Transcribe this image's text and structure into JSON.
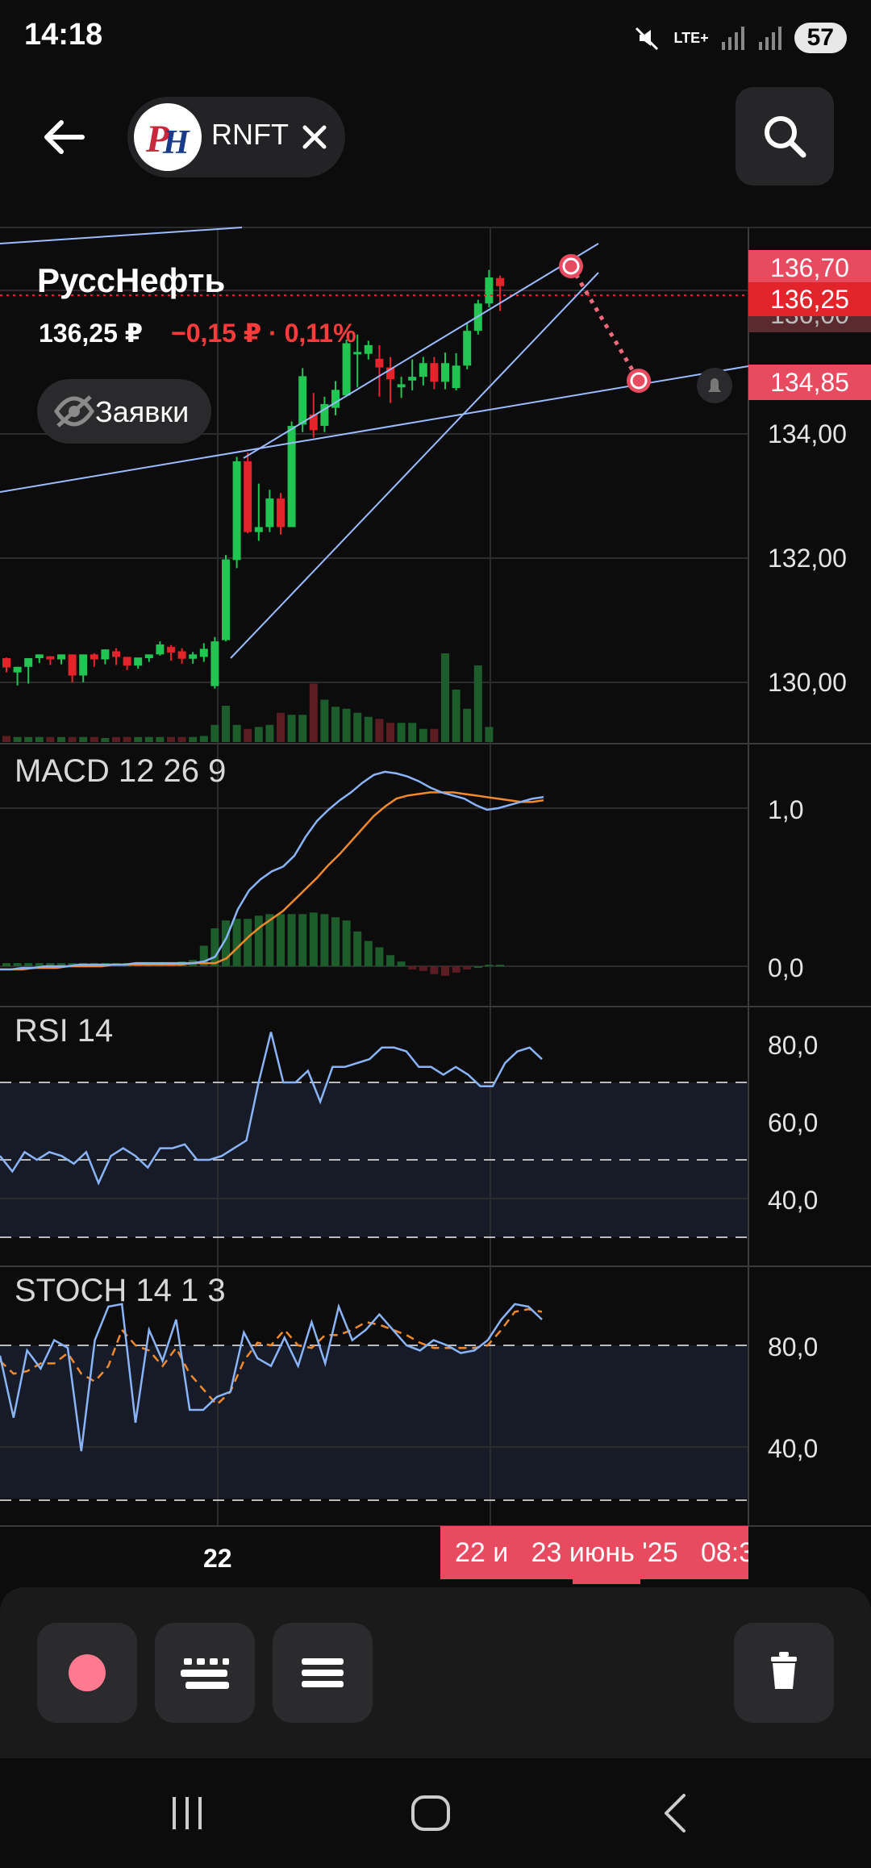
{
  "status_bar": {
    "time": "14:18",
    "network": "LTE+",
    "battery": "57",
    "icons": [
      "mute-icon",
      "lte-icon",
      "signal-icon",
      "signal-icon",
      "battery-icon"
    ]
  },
  "header": {
    "ticker": "RNFT",
    "logo_text": "PH",
    "back_icon": "arrow-left-icon",
    "close_icon": "close-icon",
    "search_icon": "search-icon"
  },
  "instrument": {
    "name": "РуссНефть",
    "price": "136,25 ₽",
    "change": "−0,15 ₽ · 0,11%",
    "orders_label": "Заявки",
    "orders_icon": "eye-off-icon"
  },
  "colors": {
    "up": "#23c552",
    "down": "#e3242b",
    "line_blue": "#8ab4f8",
    "signal_orange": "#f08a2c",
    "accent_red": "#e84a5f",
    "drawing_line": "#9bbcff"
  },
  "price_tags": {
    "top": "136,70",
    "current": "136,25",
    "target": "134,85",
    "hidden": "136,00"
  },
  "time_axis": {
    "tick": "22",
    "cursor_label": "22 и   23 июнь '25   08:3("
  },
  "toolbar": {
    "buttons": [
      "record-button",
      "indicators-button",
      "menu-button",
      "delete-button"
    ]
  },
  "chart_data": [
    {
      "type": "candlestick",
      "title": "РуссНефть",
      "y_ticks": [
        "134,00",
        "132,00",
        "130,00"
      ],
      "ylim": [
        129.0,
        137.2
      ],
      "candles": [
        [
          130.39,
          130.4,
          130.24,
          130.16
        ],
        [
          130.16,
          130.25,
          130.25,
          129.95
        ],
        [
          130.25,
          130.36,
          130.39,
          129.98
        ],
        [
          130.39,
          130.45,
          130.45,
          130.31
        ],
        [
          130.42,
          130.42,
          130.37,
          130.28
        ],
        [
          130.37,
          130.45,
          130.45,
          130.29
        ],
        [
          130.45,
          130.45,
          130.11,
          130.0
        ],
        [
          130.11,
          130.45,
          130.45,
          130.0
        ],
        [
          130.45,
          130.47,
          130.37,
          130.25
        ],
        [
          130.37,
          130.53,
          130.53,
          130.29
        ],
        [
          130.5,
          130.55,
          130.41,
          130.28
        ],
        [
          130.41,
          130.41,
          130.27,
          130.2
        ],
        [
          130.27,
          130.4,
          130.4,
          130.22
        ],
        [
          130.39,
          130.45,
          130.45,
          130.33
        ],
        [
          130.45,
          130.66,
          130.61,
          130.43
        ],
        [
          130.57,
          130.6,
          130.48,
          130.35
        ],
        [
          130.5,
          130.55,
          130.38,
          130.3
        ],
        [
          130.38,
          130.49,
          130.45,
          130.3
        ],
        [
          130.41,
          130.63,
          130.54,
          130.33
        ],
        [
          129.94,
          130.73,
          130.66,
          129.9
        ],
        [
          130.68,
          132.05,
          131.98,
          130.66
        ],
        [
          131.97,
          133.63,
          133.56,
          131.84
        ],
        [
          133.56,
          133.7,
          132.42,
          132.4
        ],
        [
          132.42,
          133.2,
          132.5,
          132.28
        ],
        [
          132.5,
          133.1,
          132.96,
          132.42
        ],
        [
          132.96,
          133.05,
          132.5,
          132.38
        ],
        [
          132.5,
          134.2,
          134.13,
          132.5
        ],
        [
          134.15,
          135.06,
          134.93,
          134.03
        ],
        [
          134.31,
          134.66,
          134.06,
          133.94
        ],
        [
          134.13,
          134.6,
          134.48,
          134.03
        ],
        [
          134.42,
          134.85,
          134.71,
          134.3
        ],
        [
          134.62,
          135.52,
          135.46,
          134.6
        ],
        [
          135.3,
          135.6,
          135.32,
          134.75
        ],
        [
          135.29,
          135.5,
          135.43,
          135.2
        ],
        [
          135.21,
          135.43,
          135.07,
          134.6
        ],
        [
          135.07,
          135.24,
          134.88,
          134.5
        ],
        [
          134.75,
          134.92,
          134.8,
          134.58
        ],
        [
          134.86,
          135.2,
          134.92,
          134.7
        ],
        [
          134.92,
          135.24,
          135.14,
          134.78
        ],
        [
          135.14,
          135.24,
          134.84,
          134.72
        ],
        [
          134.84,
          135.31,
          135.14,
          134.72
        ],
        [
          134.74,
          135.3,
          135.1,
          134.7
        ],
        [
          135.1,
          135.79,
          135.66,
          135.04
        ],
        [
          135.66,
          136.16,
          136.1,
          135.6
        ],
        [
          136.1,
          136.64,
          136.52,
          136.04
        ],
        [
          136.51,
          136.55,
          136.38,
          135.98
        ]
      ],
      "volumes": [
        0.06,
        0.05,
        0.05,
        0.05,
        0.05,
        0.05,
        0.05,
        0.05,
        0.05,
        0.04,
        0.05,
        0.05,
        0.05,
        0.05,
        0.05,
        0.05,
        0.05,
        0.05,
        0.06,
        0.17,
        0.36,
        0.17,
        0.13,
        0.15,
        0.17,
        0.29,
        0.27,
        0.27,
        0.58,
        0.42,
        0.35,
        0.33,
        0.29,
        0.25,
        0.23,
        0.19,
        0.19,
        0.19,
        0.13,
        0.13,
        0.88,
        0.52,
        0.33,
        0.76,
        0.15
      ]
    },
    {
      "type": "line",
      "title": "MACD 12 26 9",
      "y_ticks": [
        "1,0",
        "0,0"
      ],
      "ylim": [
        -0.1,
        1.3
      ],
      "macd": [
        -0.02,
        -0.02,
        -0.01,
        -0.01,
        0.0,
        0.0,
        0.0,
        0.01,
        0.01,
        0.01,
        0.01,
        0.01,
        0.02,
        0.02,
        0.02,
        0.02,
        0.02,
        0.02,
        0.03,
        0.06,
        0.18,
        0.36,
        0.48,
        0.55,
        0.6,
        0.63,
        0.7,
        0.82,
        0.92,
        0.99,
        1.05,
        1.1,
        1.16,
        1.21,
        1.23,
        1.22,
        1.2,
        1.17,
        1.13,
        1.1,
        1.08,
        1.06,
        1.02,
        0.99,
        1.0,
        1.02,
        1.04,
        1.06,
        1.07
      ],
      "signal": [
        -0.02,
        -0.02,
        -0.02,
        -0.01,
        -0.01,
        -0.01,
        0.0,
        0.0,
        0.0,
        0.0,
        0.01,
        0.01,
        0.01,
        0.01,
        0.01,
        0.01,
        0.01,
        0.02,
        0.02,
        0.02,
        0.05,
        0.12,
        0.19,
        0.25,
        0.3,
        0.35,
        0.42,
        0.49,
        0.56,
        0.64,
        0.71,
        0.79,
        0.87,
        0.95,
        1.01,
        1.06,
        1.08,
        1.09,
        1.1,
        1.1,
        1.1,
        1.09,
        1.08,
        1.07,
        1.06,
        1.05,
        1.04,
        1.04,
        1.05
      ],
      "histogram": [
        0.02,
        0.02,
        0.02,
        0.02,
        0.02,
        0.02,
        0.02,
        0.02,
        0.02,
        0.02,
        0.02,
        0.02,
        0.02,
        0.02,
        0.02,
        0.02,
        0.03,
        0.04,
        0.13,
        0.24,
        0.29,
        0.3,
        0.3,
        0.32,
        0.33,
        0.33,
        0.33,
        0.33,
        0.34,
        0.33,
        0.31,
        0.29,
        0.22,
        0.16,
        0.12,
        0.07,
        0.03,
        -0.02,
        -0.03,
        -0.05,
        -0.06,
        -0.04,
        -0.02,
        0.0,
        0.01,
        0.01
      ]
    },
    {
      "type": "line",
      "title": "RSI 14",
      "y_ticks": [
        "80,0",
        "60,0",
        "40,0"
      ],
      "ylim": [
        30,
        90
      ],
      "overbought": 70,
      "oversold": 30,
      "midline": 50,
      "values": [
        51,
        47,
        52,
        50,
        52,
        51,
        49,
        52,
        44,
        51,
        53,
        51,
        48,
        53,
        53,
        54,
        50,
        50,
        51,
        53,
        55,
        70,
        83,
        70,
        70,
        73,
        65,
        74,
        74,
        75,
        76,
        79,
        79,
        78,
        74,
        74,
        72,
        74,
        72,
        69,
        69,
        75,
        78,
        79,
        76
      ]
    },
    {
      "type": "line",
      "title": "STOCH 14 1 3",
      "y_ticks": [
        "80,0",
        "40,0"
      ],
      "ylim": [
        20,
        100
      ],
      "upper": 80,
      "lower": 20,
      "k": [
        76,
        52,
        78,
        71,
        82,
        79,
        39,
        82,
        95,
        96,
        50,
        86,
        74,
        90,
        55,
        55,
        60,
        62,
        85,
        75,
        72,
        83,
        72,
        89,
        73,
        95,
        82,
        86,
        92,
        86,
        80,
        78,
        82,
        80,
        77,
        78,
        82,
        90,
        96,
        95,
        90
      ],
      "d": [
        74,
        69,
        70,
        73,
        73,
        77,
        69,
        66,
        72,
        86,
        80,
        78,
        72,
        79,
        69,
        63,
        57,
        62,
        74,
        81,
        80,
        86,
        80,
        79,
        84,
        84,
        86,
        89,
        88,
        86,
        84,
        81,
        79,
        79,
        79,
        79,
        80,
        86,
        93,
        94,
        93
      ]
    }
  ]
}
